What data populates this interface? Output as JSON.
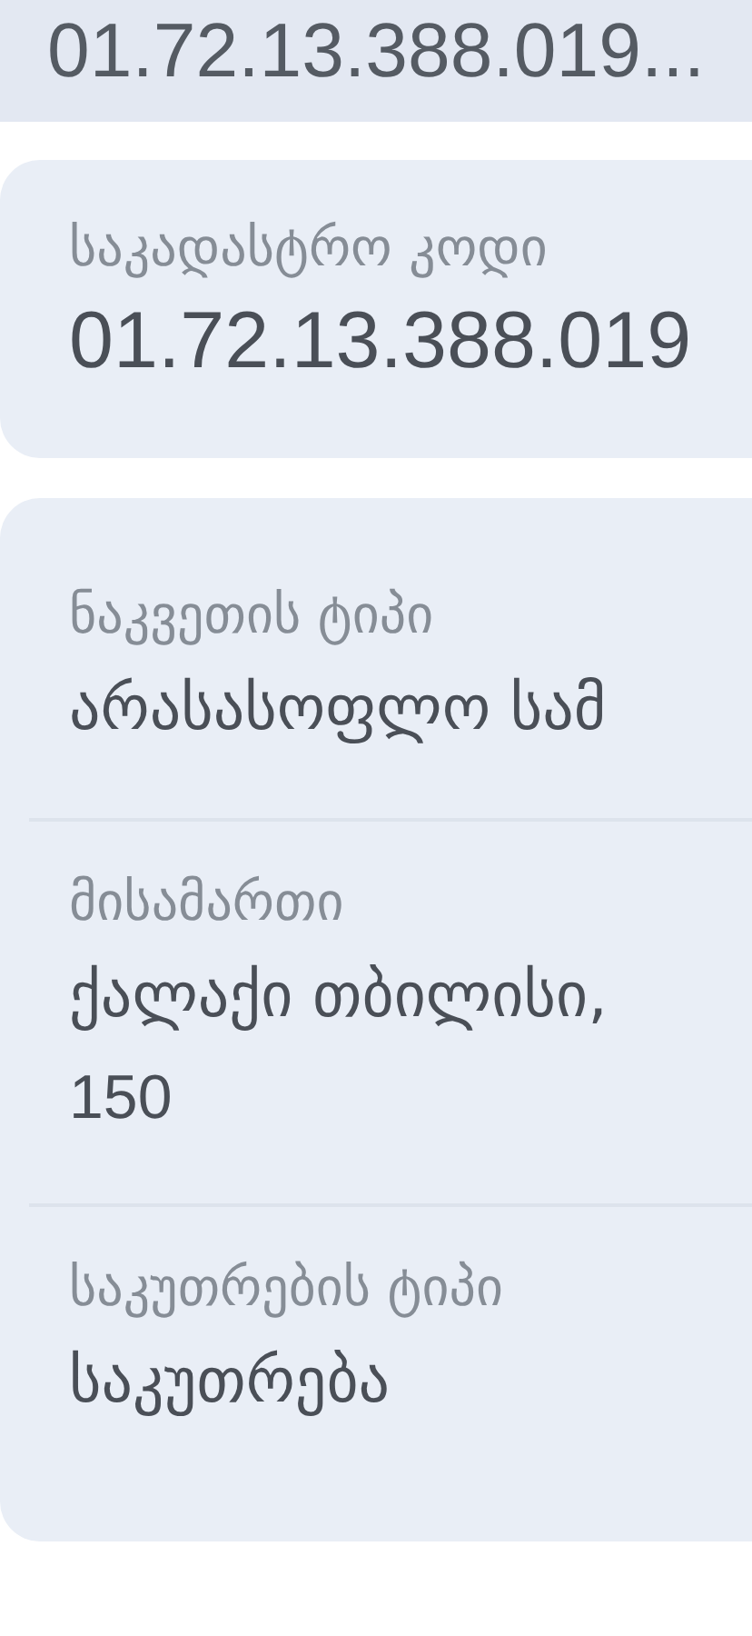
{
  "top_card": {
    "value": "01.72.13.388.019..."
  },
  "cadastral_card": {
    "label": "საკადასტრო კოდი",
    "value": "01.72.13.388.019"
  },
  "details": [
    {
      "label": "ნაკვეთის ტიპი",
      "value_lines": [
        "არასასოფლო სამ"
      ]
    },
    {
      "label": "მისამართი",
      "value_lines": [
        "ქალაქი თბილისი,",
        "150"
      ]
    },
    {
      "label": "საკუთრების ტიპი",
      "value_lines": [
        "საკუთრება"
      ]
    }
  ]
}
